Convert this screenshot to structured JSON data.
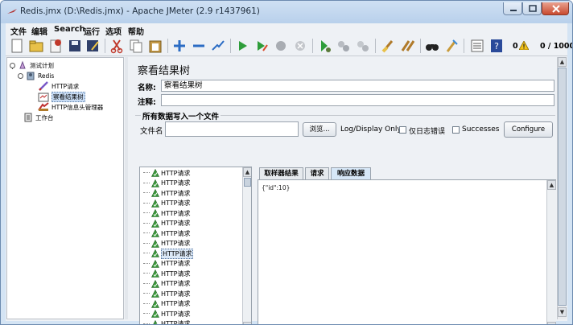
{
  "window": {
    "title": "Redis.jmx (D:\\Redis.jmx) - Apache JMeter (2.9 r1437961)"
  },
  "menu": [
    "文件",
    "编辑",
    "Search",
    "运行",
    "选项",
    "帮助"
  ],
  "toolbar": {
    "icons": [
      "new-icon",
      "open-icon",
      "close-file-icon",
      "save-icon",
      "save-as-icon",
      "cut-icon",
      "copy-icon",
      "paste-icon",
      "expand-icon",
      "collapse-icon",
      "toggle-icon",
      "start-icon",
      "start-no-pause-icon",
      "stop-icon",
      "shutdown-icon",
      "remote-start-icon",
      "remote-stop-icon",
      "remote-shutdown-icon",
      "clear-icon",
      "clear-all-icon",
      "search-icon",
      "reset-search-icon",
      "function-helper-icon",
      "help-icon"
    ],
    "error_count": "0",
    "thread_count": "0 / 1000"
  },
  "tree": {
    "nodes": [
      {
        "label": "测试计划",
        "icon": "test-plan-icon"
      },
      {
        "label": "Redis",
        "icon": "thread-group-icon"
      },
      {
        "label": "HTTP请求",
        "icon": "sampler-icon"
      },
      {
        "label": "察看结果树",
        "icon": "listener-icon"
      },
      {
        "label": "HTTP信息头管理器",
        "icon": "config-element-icon"
      },
      {
        "label": "工作台",
        "icon": "workbench-icon"
      }
    ],
    "selected": "察看结果树"
  },
  "panel": {
    "title": "察看结果树",
    "name_label": "名称:",
    "name_value": "察看结果树",
    "comment_label": "注释:",
    "comment_value": "",
    "file_section_title": "所有数据写入一个文件",
    "filename_label": "文件名",
    "filename_value": "",
    "browse_button": "浏览...",
    "log_display_label": "Log/Display Only:",
    "errors_checkbox": "仅日志错误",
    "successes_checkbox": "Successes",
    "configure_button": "Configure"
  },
  "results": {
    "items": [
      "HTTP请求",
      "HTTP请求",
      "HTTP请求",
      "HTTP请求",
      "HTTP请求",
      "HTTP请求",
      "HTTP请求",
      "HTTP请求",
      "HTTP请求",
      "HTTP请求",
      "HTTP请求",
      "HTTP请求",
      "HTTP请求",
      "HTTP请求",
      "HTTP请求",
      "HTTP请求",
      "HTTP请求"
    ],
    "selected_index": 8,
    "status_color": "#3c9a3c"
  },
  "tabs": [
    "取样器结果",
    "请求",
    "响应数据"
  ],
  "active_tab": "响应数据",
  "response_data": "{\"id\":10}"
}
